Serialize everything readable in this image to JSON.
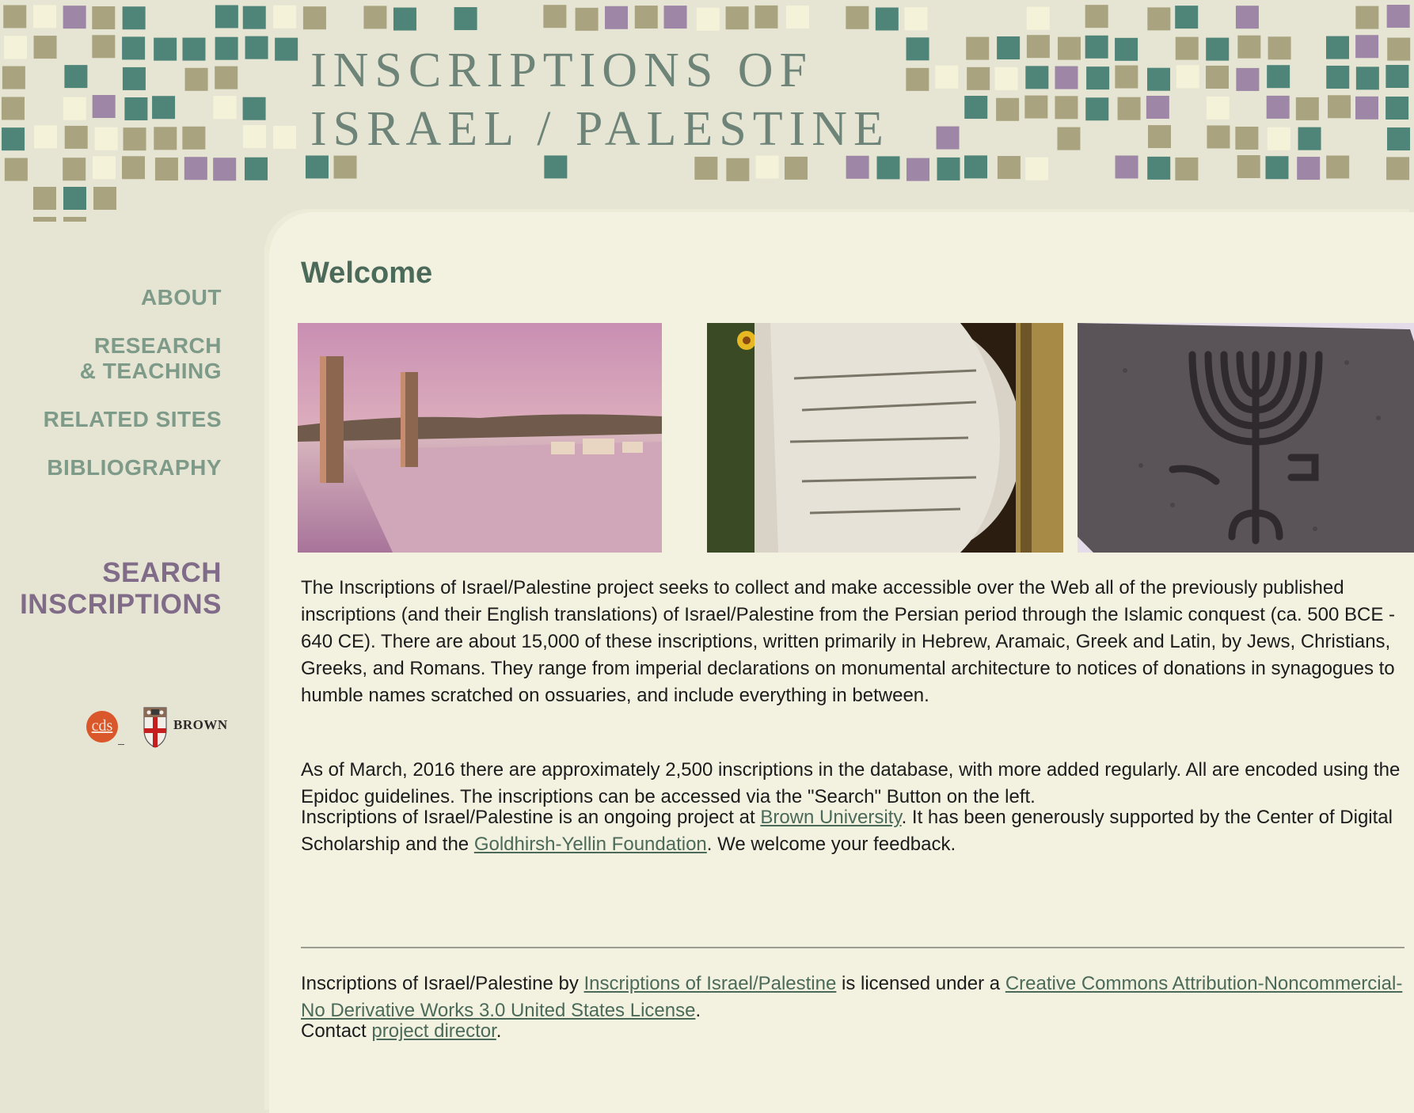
{
  "header": {
    "title_line1": "INSCRIPTIONS OF",
    "title_line2": "ISRAEL / PALESTINE"
  },
  "sidebar": {
    "nav": [
      {
        "label": "ABOUT"
      },
      {
        "label_line1": "RESEARCH",
        "label_line2": "& TEACHING"
      },
      {
        "label": "RELATED SITES"
      },
      {
        "label": "BIBLIOGRAPHY"
      }
    ],
    "search_line1": "SEARCH",
    "search_line2": "INSCRIPTIONS",
    "logos": {
      "cds": "cds",
      "brown": "BROWN"
    }
  },
  "main": {
    "heading": "Welcome",
    "photos": [
      {
        "icon": "ancient-road-columns-photo"
      },
      {
        "icon": "greek-inscription-column-photo"
      },
      {
        "icon": "menorah-relief-photo"
      }
    ],
    "para1": "The Inscriptions of Israel/Palestine project seeks to collect and make accessible over the Web all of the previously published inscriptions (and their English translations) of Israel/Palestine from the Persian period through the Islamic conquest (ca. 500 BCE - 640 CE). There are about 15,000 of these inscriptions, written primarily in Hebrew, Aramaic, Greek and Latin, by Jews, Christians, Greeks, and Romans. They range from imperial declarations on monumental architecture to notices of donations in synagogues to humble names scratched on ossuaries, and include everything in between.",
    "para2": "As of March, 2016 there are approximately 2,500 inscriptions in the database, with more added regularly. All are encoded using the Epidoc guidelines. The inscriptions can be accessed via the \"Search\" Button on the left.",
    "para3": {
      "t1": "Inscriptions of Israel/Palestine is an ongoing project at ",
      "link1": "Brown University",
      "t2": ". It has been generously supported by the Center of Digital Scholarship and the ",
      "link2": "Goldhirsh-Yellin Foundation",
      "t3": ". We welcome your feedback."
    },
    "license": {
      "t1": "Inscriptions of Israel/Palestine by ",
      "link1": "Inscriptions of Israel/Palestine",
      "t2": " is licensed under a ",
      "link2": "Creative Commons Attribution-Noncommercial-No Derivative Works 3.0 United States License",
      "t3": "."
    },
    "contact": {
      "t1": "Contact ",
      "link": "project director",
      "t2": "."
    }
  },
  "colors": {
    "background": "#e6e5d3",
    "content_bg": "#f3f1e0",
    "nav_green": "#7e9a88",
    "search_purple": "#806b89",
    "heading_green": "#4b6a59",
    "tile_olive": "#a9a37f",
    "tile_teal": "#4f8479",
    "tile_purple": "#9d86a6",
    "tile_cream": "#f4f2d8"
  }
}
